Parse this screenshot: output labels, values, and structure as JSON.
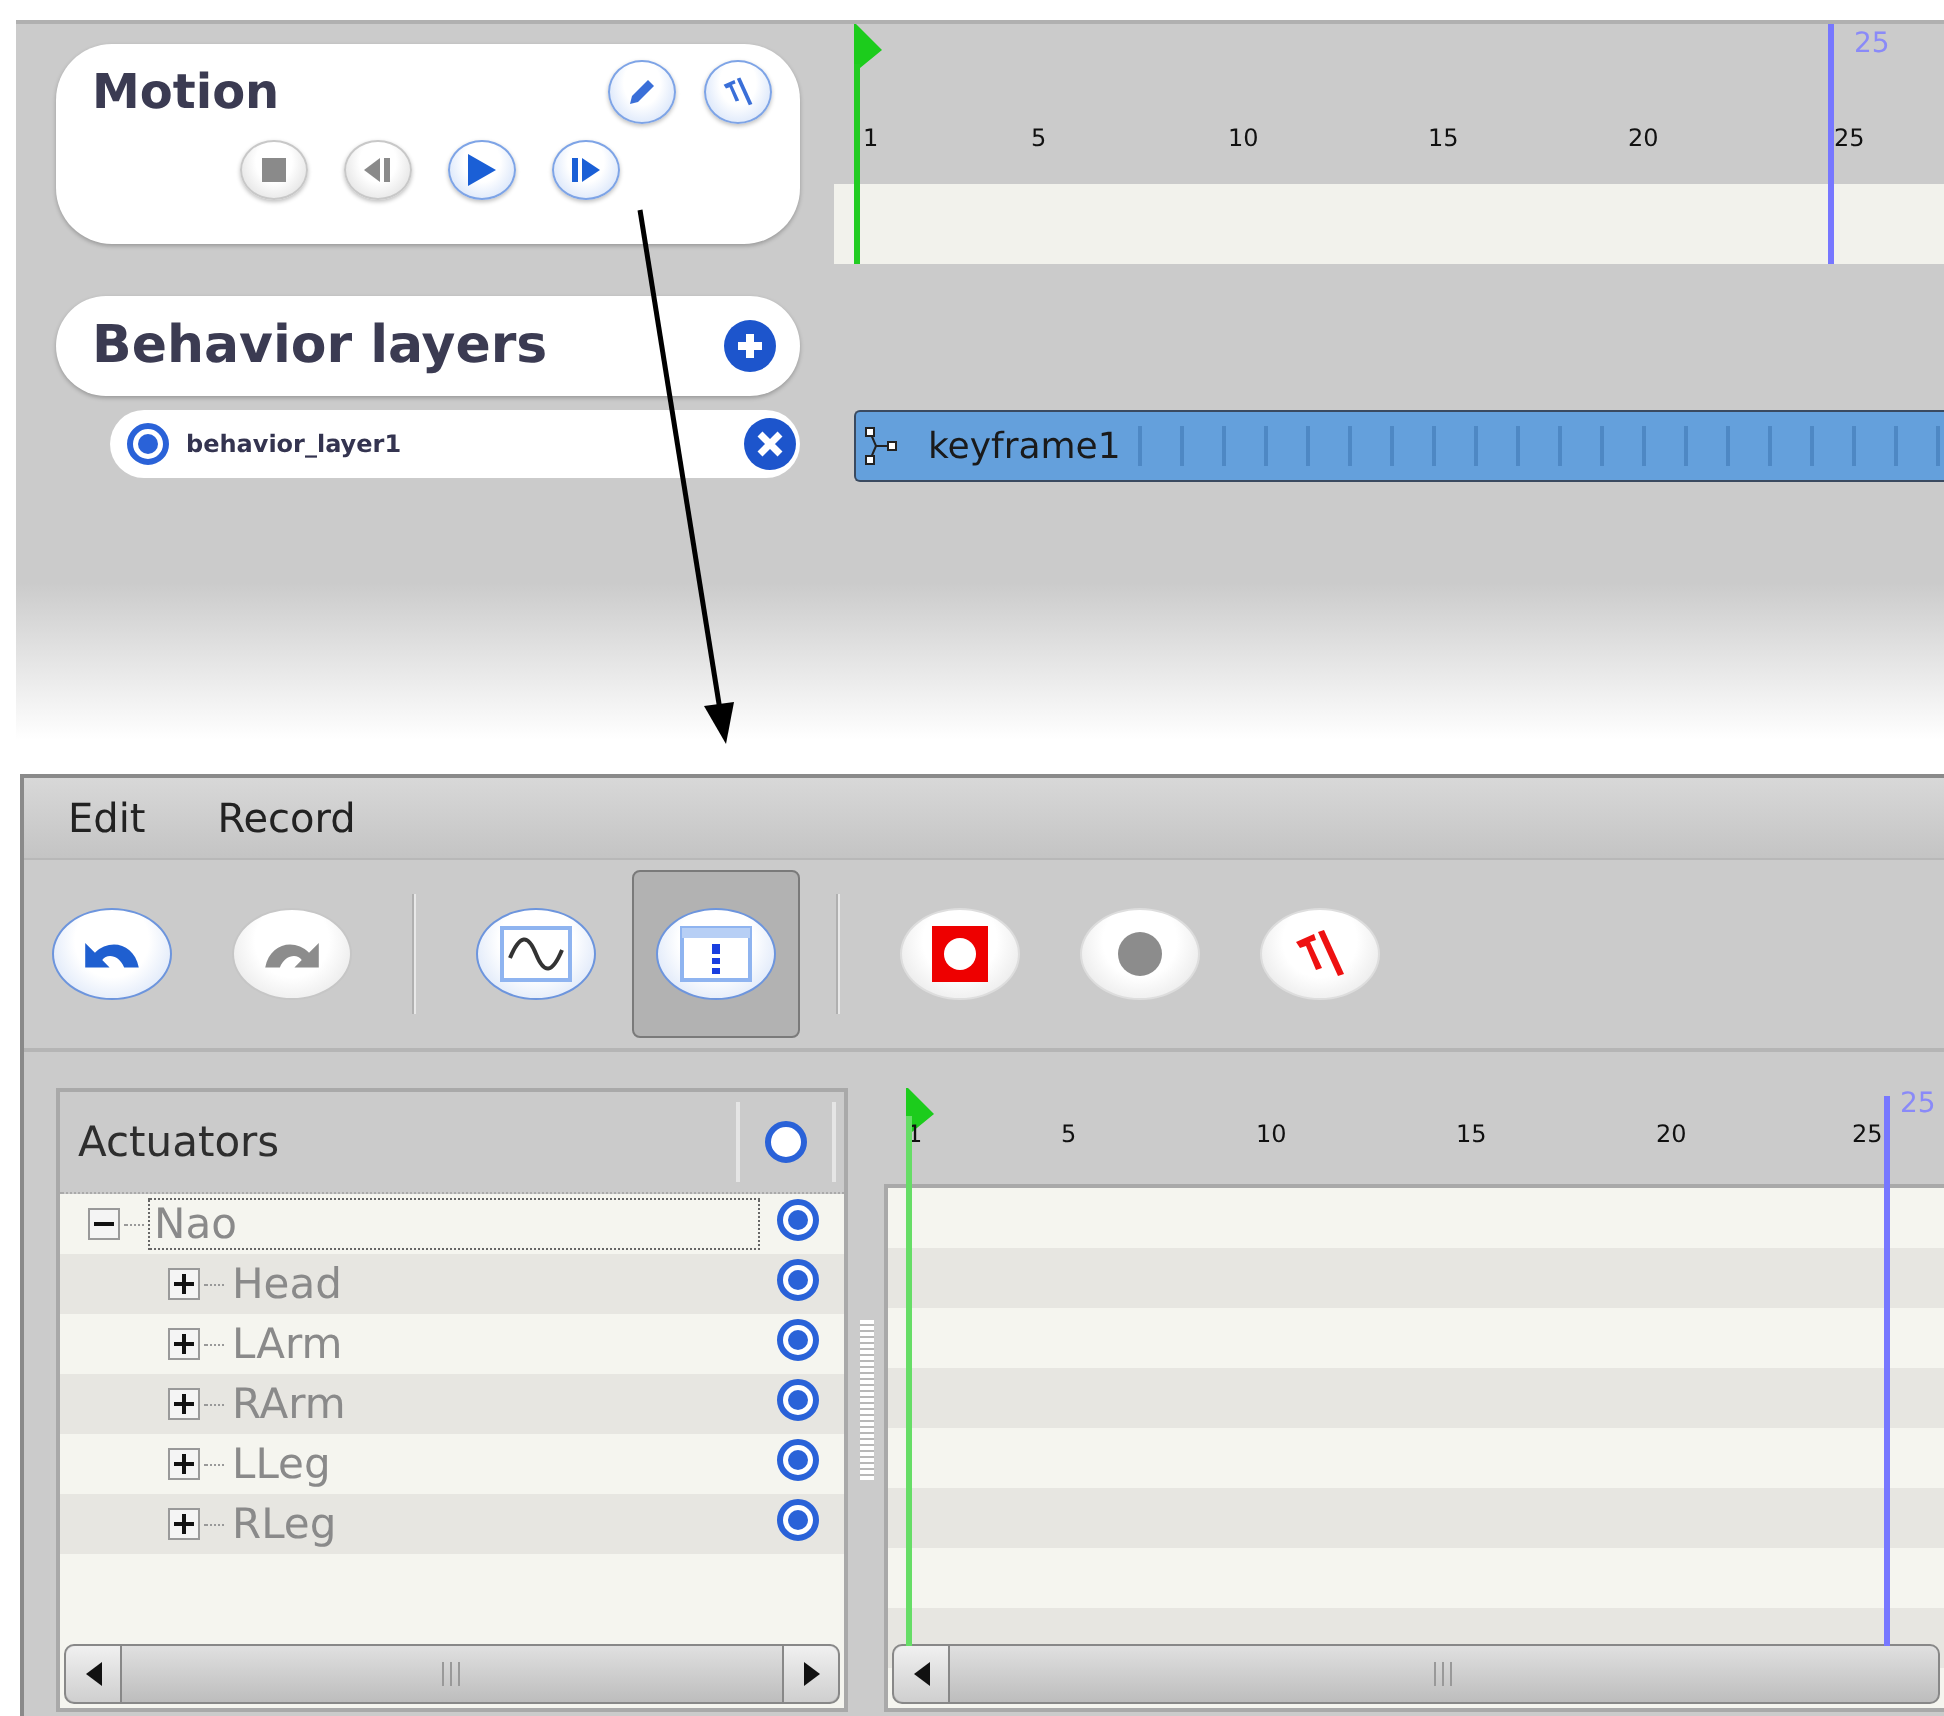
{
  "motion": {
    "title": "Motion",
    "tools": [
      {
        "kind": "pencil"
      },
      {
        "kind": "tools"
      }
    ],
    "transport": [
      {
        "kind": "stop",
        "disabled": true
      },
      {
        "kind": "previous",
        "disabled": true
      },
      {
        "kind": "play",
        "disabled": false
      },
      {
        "kind": "next",
        "disabled": false
      }
    ]
  },
  "behavior_layers": {
    "title": "Behavior layers",
    "layers": [
      {
        "name": "behavior_layer1",
        "selected": true
      }
    ]
  },
  "timeline": {
    "ticks": [
      "1",
      "5",
      "10",
      "15",
      "20",
      "25"
    ],
    "end_label": "25",
    "keyframes": [
      {
        "name": "keyframe1"
      }
    ]
  },
  "editor": {
    "menu": [
      "Edit",
      "Record"
    ],
    "toolbar": [
      {
        "kind": "undo",
        "disabled": false,
        "selected": false
      },
      {
        "kind": "redo",
        "disabled": true,
        "selected": false
      },
      {
        "kind": "separator"
      },
      {
        "kind": "curves",
        "disabled": false,
        "selected": false
      },
      {
        "kind": "dopesheet",
        "disabled": false,
        "selected": true
      },
      {
        "kind": "separator"
      },
      {
        "kind": "record-stop",
        "selected": false
      },
      {
        "kind": "record",
        "disabled": true,
        "selected": false
      },
      {
        "kind": "tools",
        "selected": false
      }
    ],
    "actuators": {
      "header": "Actuators",
      "header_on": false,
      "tree": [
        {
          "label": "Nao",
          "expanded": true,
          "focused": true,
          "on": true,
          "children": [
            {
              "label": "Head",
              "expanded": false,
              "focused": false,
              "on": true
            },
            {
              "label": "LArm",
              "expanded": false,
              "focused": false,
              "on": true
            },
            {
              "label": "RArm",
              "expanded": false,
              "focused": false,
              "on": true
            },
            {
              "label": "LLeg",
              "expanded": false,
              "focused": false,
              "on": true
            },
            {
              "label": "RLeg",
              "expanded": false,
              "focused": false,
              "on": true
            }
          ]
        }
      ]
    },
    "timeline": {
      "ticks": [
        "1",
        "5",
        "10",
        "15",
        "20",
        "25"
      ],
      "end_label": "25"
    }
  }
}
